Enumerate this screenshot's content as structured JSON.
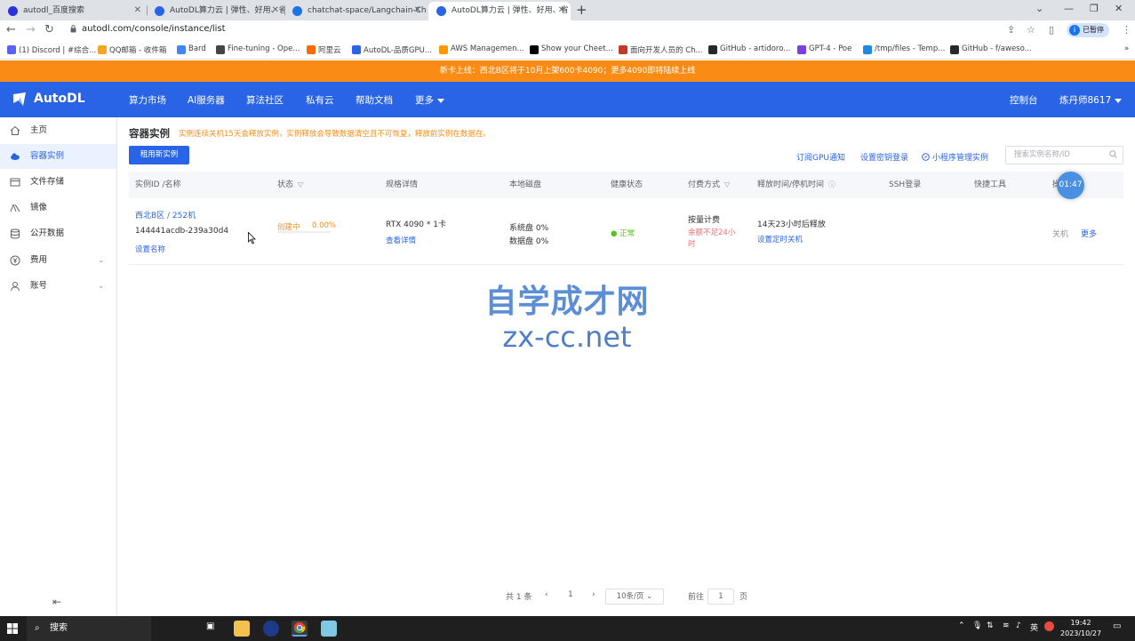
{
  "browser": {
    "tabs": [
      {
        "title": "autodl_百度搜索",
        "icon_color": "#2932e1"
      },
      {
        "title": "AutoDL算力云 | 弹性、好用、省",
        "icon_color": "#2a64e6"
      },
      {
        "title": "chatchat-space/Langchain-Ch",
        "icon_color": "#1a73e8"
      },
      {
        "title": "AutoDL算力云 | 弹性、好用、省",
        "icon_color": "#2a64e6"
      }
    ],
    "new_tab": "+",
    "url": "autodl.com/console/instance/list",
    "profile_label": "已暂停",
    "profile_initial": "i",
    "bookmarks": [
      {
        "label": "(1) Discord | #综合...",
        "color": "#5865f2"
      },
      {
        "label": "QQ邮箱 - 收件箱",
        "color": "#f5a623"
      },
      {
        "label": "Bard",
        "color": "#4285f4"
      },
      {
        "label": "Fine-tuning - Ope...",
        "color": "#444444"
      },
      {
        "label": "阿里云",
        "color": "#ff6a00"
      },
      {
        "label": "AutoDL-品质GPU...",
        "color": "#2a64e6"
      },
      {
        "label": "AWS Managemen...",
        "color": "#f90"
      },
      {
        "label": "Show your Cheet...",
        "color": "#000000"
      },
      {
        "label": "面向开发人员的 Ch...",
        "color": "#c0392b"
      },
      {
        "label": "GitHub - artidoro...",
        "color": "#24292f"
      },
      {
        "label": "GPT-4 - Poe",
        "color": "#7b3fe4"
      },
      {
        "label": "/tmp/files - Temp...",
        "color": "#1e88e5"
      },
      {
        "label": "GitHub - f/aweso...",
        "color": "#24292f"
      }
    ],
    "more_bookmarks": "»"
  },
  "site": {
    "notice": "新卡上线：西北B区将于10月上架600卡4090；更多4090即将陆续上线",
    "brand": "AutoDL",
    "nav": [
      "算力市场",
      "AI服务器",
      "算法社区",
      "私有云",
      "帮助文档",
      "更多"
    ],
    "console": "控制台",
    "user": "炼丹师8617"
  },
  "sidebar": {
    "items": [
      {
        "label": "主页",
        "icon": "home-icon"
      },
      {
        "label": "容器实例",
        "icon": "cloud-icon"
      },
      {
        "label": "文件存储",
        "icon": "folder-icon"
      },
      {
        "label": "镜像",
        "icon": "layers-icon"
      },
      {
        "label": "公开数据",
        "icon": "database-icon"
      },
      {
        "label": "费用",
        "icon": "yen-icon"
      },
      {
        "label": "账号",
        "icon": "user-icon"
      }
    ],
    "active_index": 1
  },
  "main": {
    "title": "容器实例",
    "warning": "实例连续关机15天会释放实例，实例释放会导致数据清空且不可恢复，释放前实例在数据在。",
    "rent_button": "租用新实例",
    "links": {
      "gpu_notice": "订阅GPU通知",
      "ssh_key": "设置密钥登录",
      "mini_program": "小程序管理实例"
    },
    "search_placeholder": "搜索实例名称/ID",
    "columns": [
      "实例ID /名称",
      "状态",
      "规格详情",
      "本地磁盘",
      "健康状态",
      "付费方式",
      "释放时间/停机时间",
      "SSH登录",
      "快捷工具",
      "操作"
    ],
    "row": {
      "region": "西北B区 / 252机",
      "instance_id": "144441acdb-239a30d4",
      "set_name": "设置名称",
      "status": "创建中",
      "progress": "0.00%",
      "spec": "RTX 4090 * 1卡",
      "spec_detail": "查看详情",
      "disk_system": "系统盘 0%",
      "disk_data": "数据盘 0%",
      "health": "正常",
      "billing": "按量计费",
      "balance_warn_1": "余额不足24小",
      "balance_warn_2": "时",
      "release": "14天23小时后释放",
      "set_shutdown": "设置定时关机",
      "shutdown": "关机",
      "more": "更多"
    },
    "pagination": {
      "total": "共 1 条",
      "prev": "‹",
      "page": "1",
      "next": "›",
      "page_size": "10条/页",
      "goto": "前往",
      "goto_value": "1",
      "page_suffix": "页"
    }
  },
  "overlay": {
    "timer": "01:47",
    "watermark_title": "自学成才网",
    "watermark_url": "zx-cc.net"
  },
  "taskbar": {
    "search": "搜索",
    "tray": "英",
    "time": "19:42",
    "date": "2023/10/27"
  }
}
